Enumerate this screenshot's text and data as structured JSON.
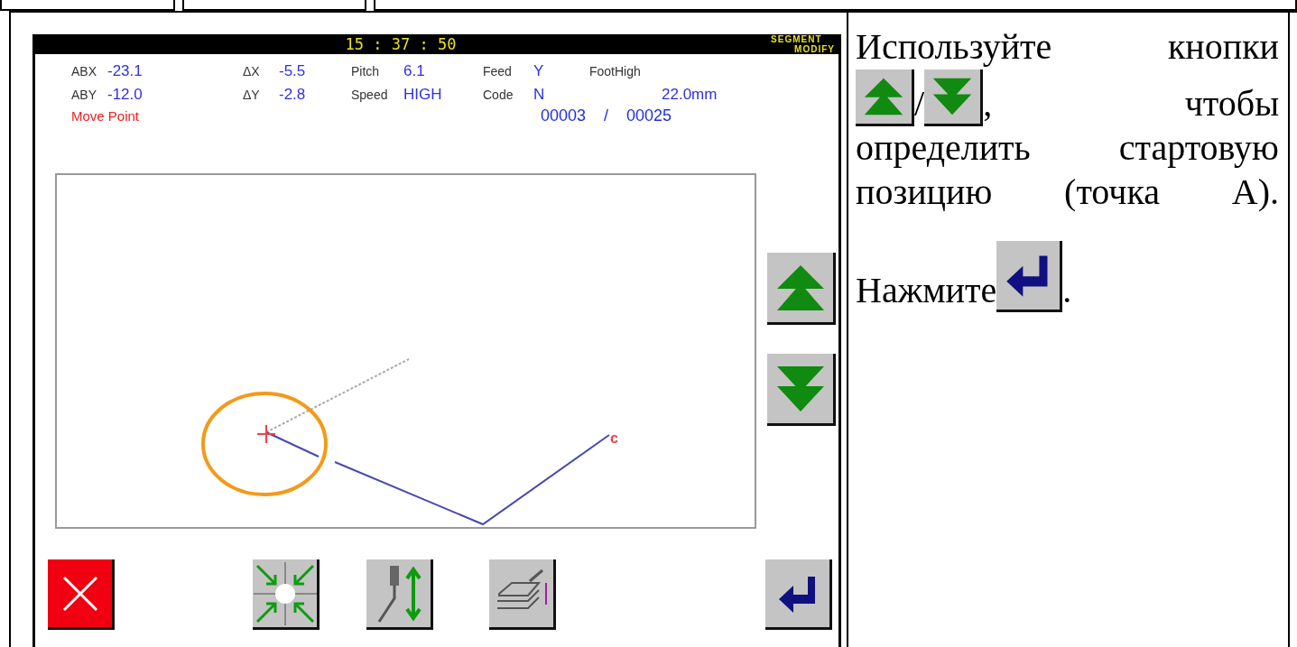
{
  "screen": {
    "time": "15 : 37 : 50",
    "mode_title": [
      "SEGMENT",
      "MODIFY"
    ],
    "info_rows": [
      [
        {
          "label": "ABX",
          "value": "-23.1"
        },
        {
          "label": "ΔX",
          "value": "-5.5"
        },
        {
          "label": "Pitch",
          "value": "6.1"
        },
        {
          "label": "Feed",
          "value": "Y"
        },
        {
          "label": "FootHigh"
        }
      ],
      [
        {
          "label": "ABY",
          "value": "-12.0"
        },
        {
          "label": "ΔY",
          "value": "-2.8"
        },
        {
          "label": "Speed",
          "value": "HIGH"
        },
        {
          "label": "Code",
          "value": "N"
        },
        {
          "value": "22.0mm"
        }
      ]
    ],
    "status": "Move Point",
    "counter": {
      "current": "00003",
      "separator": "/",
      "total": "00025"
    },
    "canvas": {
      "point_label": "c"
    },
    "side_buttons": [
      {
        "kind": "up"
      },
      {
        "kind": "down"
      }
    ],
    "bottom_buttons": [
      {
        "kind": "cancel"
      },
      {
        "kind": "origin"
      },
      {
        "kind": "needle"
      },
      {
        "kind": "presser"
      },
      {
        "kind": "enter"
      }
    ]
  },
  "instruction": {
    "paragraphs": [
      [
        [
          {
            "kind": "text",
            "text": "Используйте кнопки"
          }
        ],
        [
          {
            "kind": "up"
          },
          {
            "kind": "text",
            "text": "/"
          },
          {
            "kind": "down"
          },
          {
            "kind": "text",
            "text": ","
          },
          {
            "kind": "text",
            "text": "чтобы"
          }
        ],
        [
          {
            "kind": "text",
            "text": "определить стартовую"
          }
        ],
        [
          {
            "kind": "text",
            "text": "позицию (точка А)."
          }
        ]
      ],
      [
        [
          {
            "kind": "text",
            "text": "Нажмите"
          },
          {
            "kind": "enter"
          },
          {
            "kind": "text",
            "text": "."
          }
        ]
      ]
    ]
  }
}
